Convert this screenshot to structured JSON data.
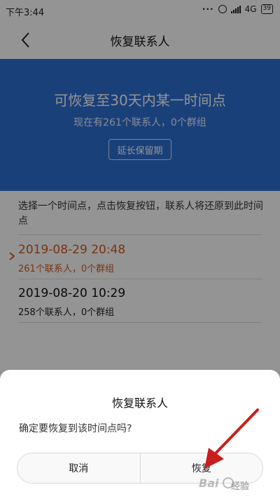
{
  "status_bar": {
    "time": "下午3:44",
    "network": "4G",
    "battery": "39"
  },
  "nav": {
    "title": "恢复联系人"
  },
  "banner": {
    "title": "可恢复至30天内某一时间点",
    "subtitle": "现在有261个联系人，0个群组",
    "extend_button": "延长保留期",
    "color": "#2d6fd3"
  },
  "instruction": "选择一个时间点，点击恢复按钮，联系人将还原到此时间点",
  "restore_points": [
    {
      "time": "2019-08-29 20:48",
      "summary": "261个联系人，0个群组",
      "selected": true
    },
    {
      "time": "2019-08-20 10:29",
      "summary": "258个联系人，0个群组",
      "selected": false
    }
  ],
  "dialog": {
    "title": "恢复联系人",
    "message": "确定要恢复到该时间点吗?",
    "cancel_label": "取消",
    "confirm_label": "恢复"
  },
  "selected_color": "#d05a1e",
  "annotation_color": "#c81e1e",
  "watermark": {
    "text": "经验"
  }
}
